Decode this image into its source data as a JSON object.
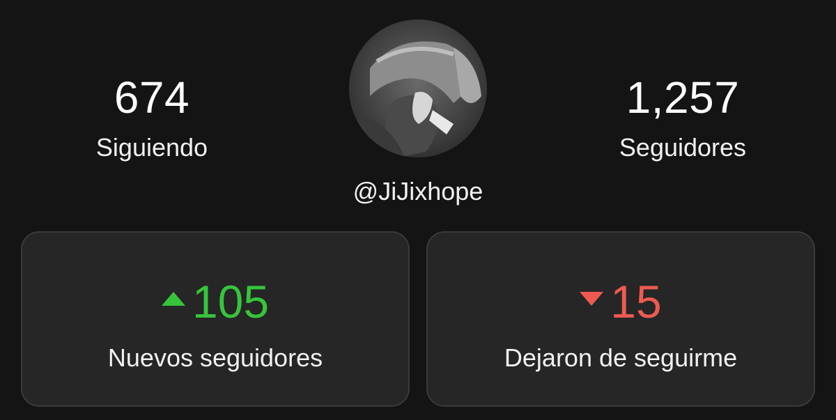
{
  "profile": {
    "handle": "@JiJixhope",
    "avatar_icon": "profile-photo"
  },
  "stats": {
    "following": {
      "value": "674",
      "label": "Siguiendo"
    },
    "followers": {
      "value": "1,257",
      "label": "Seguidores"
    }
  },
  "cards": {
    "new_followers": {
      "value": "105",
      "label": "Nuevos seguidores",
      "trend": "up",
      "color": "#36c53a"
    },
    "unfollowers": {
      "value": "15",
      "label": "Dejaron de seguirme",
      "trend": "down",
      "color": "#ee5a52"
    }
  },
  "theme": {
    "background": "#141414",
    "card_background": "#262626",
    "card_border": "#3a3a3a",
    "text": "#ffffff"
  }
}
